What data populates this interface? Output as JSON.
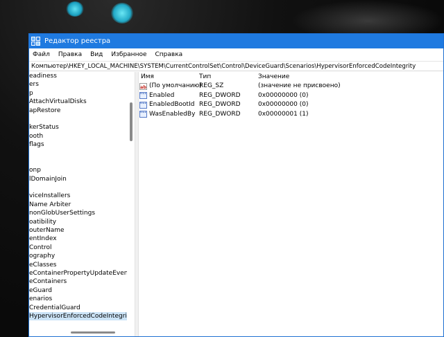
{
  "window": {
    "title": "Редактор реестра",
    "icon": "regedit-icon"
  },
  "menu": {
    "items": [
      "Файл",
      "Правка",
      "Вид",
      "Избранное",
      "Справка"
    ]
  },
  "address": {
    "path": "Компьютер\\HKEY_LOCAL_MACHINE\\SYSTEM\\CurrentControlSet\\Control\\DeviceGuard\\Scenarios\\HypervisorEnforcedCodeIntegrity"
  },
  "tree": {
    "items": [
      "eadiness",
      "ers",
      "p",
      "AttachVirtualDisks",
      "apRestore",
      "",
      "kerStatus",
      "ooth",
      "flags",
      "",
      "",
      "onp",
      "lDomainJoin",
      "",
      "viceInstallers",
      "Name Arbiter",
      "nonGlobUserSettings",
      "oatibility",
      "outerName",
      "entIndex",
      "Control",
      "ography",
      "eClasses",
      "eContainerPropertyUpdateEvents",
      "eContainers",
      "eGuard",
      "enarios",
      "CredentialGuard",
      "HypervisorEnforcedCodeIntegrity"
    ]
  },
  "values": {
    "headers": {
      "name": "Имя",
      "type": "Тип",
      "data": "Значение"
    },
    "rows": [
      {
        "icon": "string-value-icon",
        "icon_text": "ab",
        "name": "(По умолчанию)",
        "type": "REG_SZ",
        "data": "(значение не присвоено)"
      },
      {
        "icon": "binary-value-icon",
        "icon_text": "011 110",
        "name": "Enabled",
        "type": "REG_DWORD",
        "data": "0x00000000 (0)"
      },
      {
        "icon": "binary-value-icon",
        "icon_text": "011 110",
        "name": "EnabledBootId",
        "type": "REG_DWORD",
        "data": "0x00000000 (0)"
      },
      {
        "icon": "binary-value-icon",
        "icon_text": "011 110",
        "name": "WasEnabledBy",
        "type": "REG_DWORD",
        "data": "0x00000001 (1)"
      }
    ]
  },
  "colors": {
    "titlebar": "#1f7ae0",
    "selection": "#cce4f7"
  }
}
